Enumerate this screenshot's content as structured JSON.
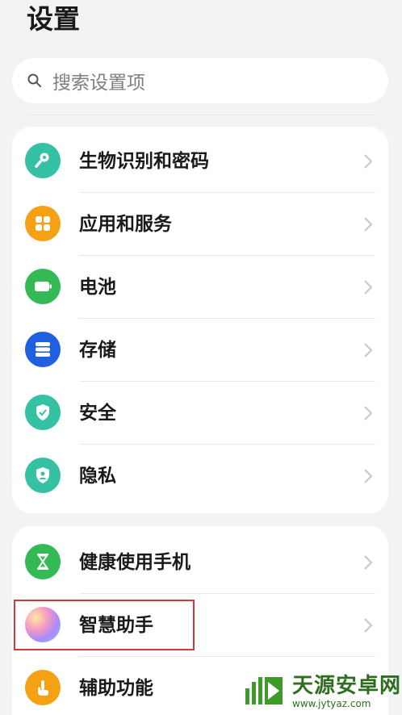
{
  "header": {
    "title": "设置"
  },
  "search": {
    "placeholder": "搜索设置项"
  },
  "group1": [
    {
      "label": "生物识别和密码",
      "icon": "key-icon",
      "color": "#35c1a3"
    },
    {
      "label": "应用和服务",
      "icon": "apps-grid-icon",
      "color": "#f5a114"
    },
    {
      "label": "电池",
      "icon": "battery-icon",
      "color": "#34b954"
    },
    {
      "label": "存储",
      "icon": "storage-icon",
      "color": "#1f5fe0"
    },
    {
      "label": "安全",
      "icon": "shield-check-icon",
      "color": "#35c1a3"
    },
    {
      "label": "隐私",
      "icon": "privacy-shield-icon",
      "color": "#35c1a3"
    }
  ],
  "group2": [
    {
      "label": "健康使用手机",
      "icon": "hourglass-icon",
      "color": "#34b954"
    },
    {
      "label": "智慧助手",
      "icon": "assistant-orb-icon",
      "color": "#c48ae0"
    },
    {
      "label": "辅助功能",
      "icon": "hand-touch-icon",
      "color": "#f5a114"
    }
  ],
  "watermark": {
    "text": "天源安卓网",
    "url": "www.jytyaz.com"
  }
}
